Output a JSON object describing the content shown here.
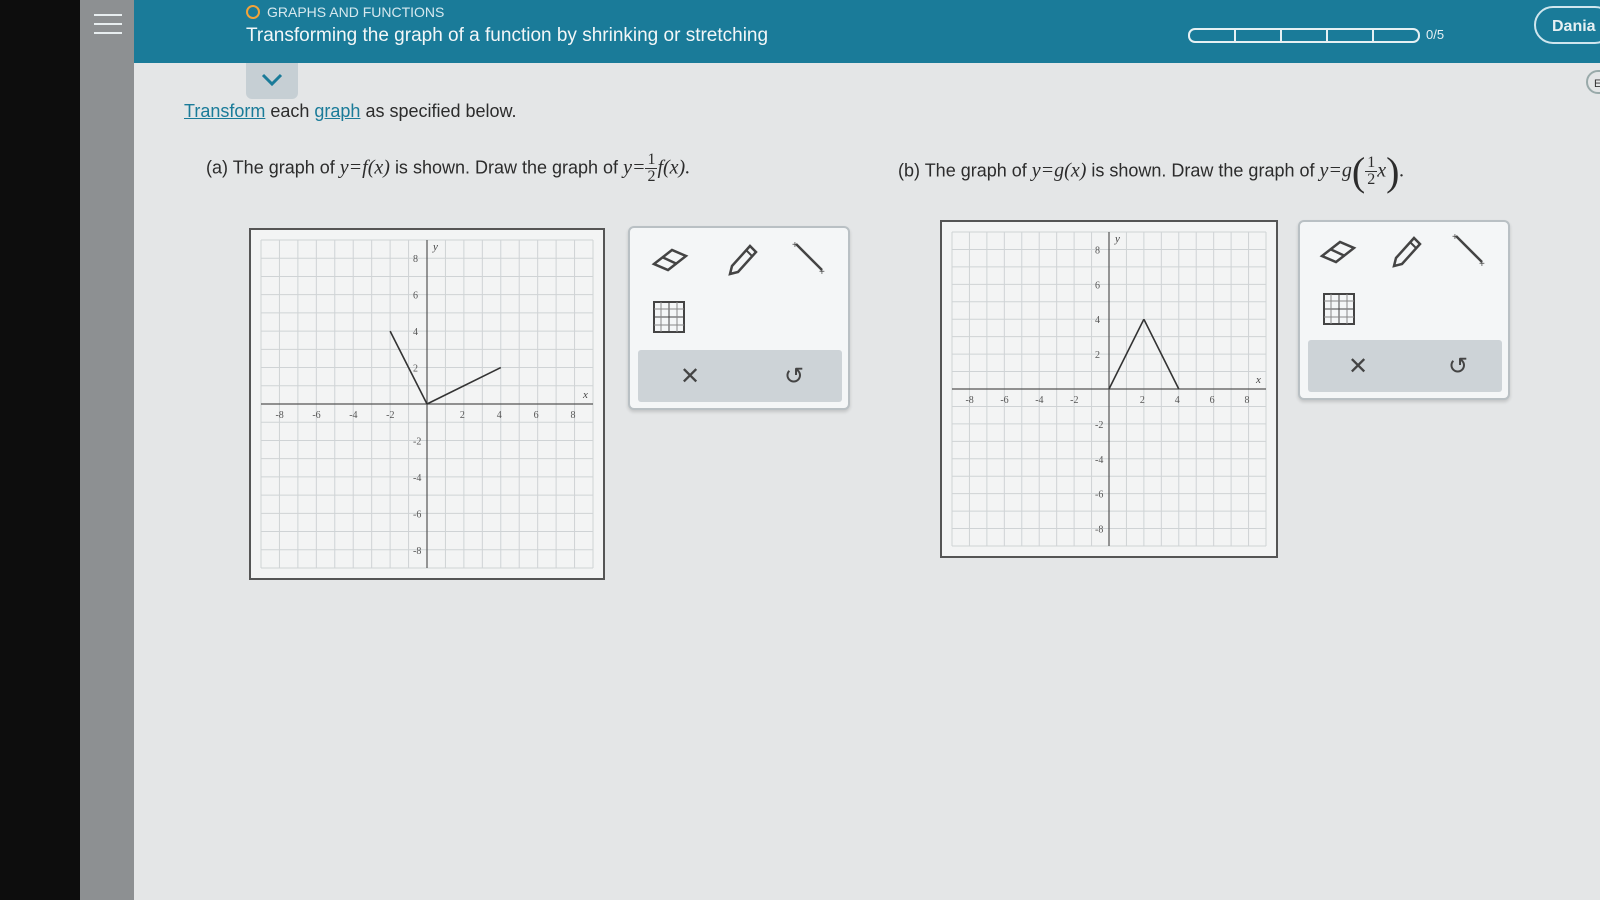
{
  "header": {
    "breadcrumb": "GRAPHS AND FUNCTIONS",
    "title": "Transforming the graph of a function by shrinking or stretching",
    "progress_text": "0/5",
    "progress_segments": 5,
    "progress_filled": 0,
    "user_label": "Dania",
    "side_tab_label": "E"
  },
  "instructions": {
    "link1": "Transform",
    "mid1": " each ",
    "link2": "graph",
    "rest": " as specified below."
  },
  "part_a": {
    "label": "(a)",
    "text1": "The graph of",
    "eq1": "y=f(x)",
    "text2": "is shown. Draw the graph of",
    "eq2_prefix": "y=",
    "frac_num": "1",
    "frac_den": "2",
    "eq2_suffix": "f(x)."
  },
  "part_b": {
    "label": "(b)",
    "text1": "The graph of",
    "eq1": "y=g(x)",
    "text2": "is shown. Draw the graph of",
    "eq2_prefix": "y=g",
    "frac_num": "1",
    "frac_den": "2",
    "eq2_var": "x",
    "eq2_suffix": "."
  },
  "graph_a": {
    "x_tick_labels": [
      "-8",
      "-6",
      "-4",
      "-2",
      "2",
      "4",
      "6",
      "8"
    ],
    "y_tick_labels": [
      "8",
      "6",
      "4",
      "2",
      "-2",
      "-4",
      "-6",
      "-8"
    ],
    "x_axis_label": "x",
    "y_axis_label": "y",
    "segments": [
      [
        [
          -2,
          4
        ],
        [
          0,
          0
        ]
      ],
      [
        [
          0,
          0
        ],
        [
          4,
          2
        ]
      ]
    ]
  },
  "graph_b": {
    "x_tick_labels": [
      "-8",
      "-6",
      "-4",
      "-2",
      "2",
      "4",
      "6",
      "8"
    ],
    "y_tick_labels": [
      "8",
      "6",
      "4",
      "2",
      "-2",
      "-4",
      "-6",
      "-8"
    ],
    "x_axis_label": "x",
    "y_axis_label": "y",
    "segments": [
      [
        [
          0,
          0
        ],
        [
          2,
          4
        ]
      ],
      [
        [
          2,
          4
        ],
        [
          4,
          0
        ]
      ]
    ]
  },
  "colors": {
    "header_bg": "#1a7b99",
    "progress_accent": "#f2a33a",
    "screen_bg": "#e4e6e7"
  },
  "icons": [
    "hamburger-icon",
    "chevron-down-icon",
    "eraser-icon",
    "pencil-icon",
    "line-tool-icon",
    "grid-tool-icon",
    "clear-icon",
    "undo-icon"
  ]
}
